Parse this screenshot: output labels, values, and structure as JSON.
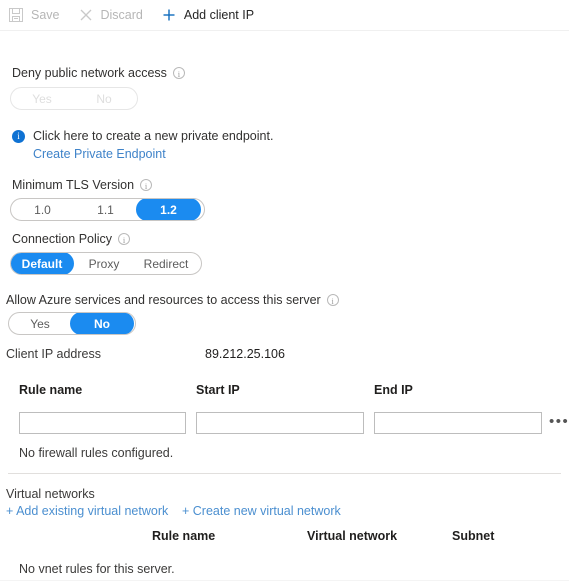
{
  "toolbar": {
    "save_label": "Save",
    "discard_label": "Discard",
    "add_client_ip_label": "Add client IP"
  },
  "deny_public_network": {
    "label": "Deny public network access",
    "options": [
      "Yes",
      "No"
    ],
    "selected": null,
    "disabled": true
  },
  "private_endpoint_banner": {
    "message": "Click here to create a new private endpoint.",
    "link": "Create Private Endpoint"
  },
  "minimum_tls_version": {
    "label": "Minimum TLS Version",
    "options": [
      "1.0",
      "1.1",
      "1.2"
    ],
    "selected": "1.2"
  },
  "connection_policy": {
    "label": "Connection Policy",
    "options": [
      "Default",
      "Proxy",
      "Redirect"
    ],
    "selected": "Default"
  },
  "allow_azure_services": {
    "label": "Allow Azure services and resources to access this server",
    "options": [
      "Yes",
      "No"
    ],
    "selected": "No"
  },
  "client_ip": {
    "label": "Client IP address",
    "value": "89.212.25.106"
  },
  "firewall_rules": {
    "headers": [
      "Rule name",
      "Start IP",
      "End IP"
    ],
    "new_row": {
      "rule_name": "",
      "start_ip": "",
      "end_ip": "",
      "more_label": "•••"
    },
    "empty_message": "No firewall rules configured."
  },
  "virtual_networks": {
    "title": "Virtual networks",
    "add_existing_link": "+ Add existing virtual network",
    "create_new_link": "+ Create new virtual network",
    "headers": [
      "Rule name",
      "Virtual network",
      "Subnet"
    ],
    "empty_message": "No vnet rules for this server."
  },
  "colors": {
    "accent_blue": "#1b8bf0",
    "link_blue": "#4b8fd0",
    "info_blue": "#0f72d3",
    "disabled_grey": "#b6b6b6"
  }
}
